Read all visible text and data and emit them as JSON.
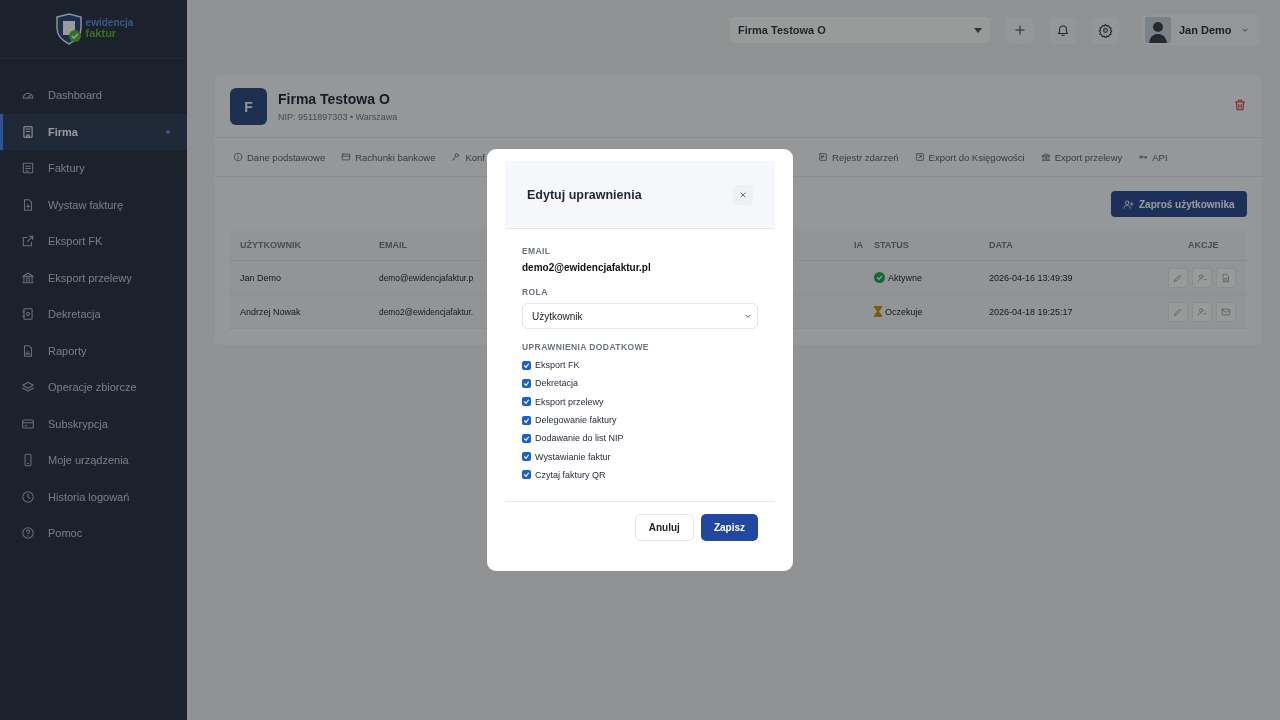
{
  "logo": {
    "line1": "ewidencja",
    "line2": "faktur"
  },
  "sidebar": {
    "items": [
      {
        "label": "Dashboard",
        "selected": false
      },
      {
        "label": "Firma",
        "selected": true
      },
      {
        "label": "Faktury",
        "selected": false
      },
      {
        "label": "Wystaw fakturę",
        "selected": false
      },
      {
        "label": "Eksport FK",
        "selected": false
      },
      {
        "label": "Eksport przelewy",
        "selected": false
      },
      {
        "label": "Dekretacja",
        "selected": false
      },
      {
        "label": "Raporty",
        "selected": false
      },
      {
        "label": "Operacje zbiorcze",
        "selected": false
      },
      {
        "label": "Subskrypcja",
        "selected": false
      },
      {
        "label": "Moje urządzenia",
        "selected": false
      },
      {
        "label": "Historia logowań",
        "selected": false
      },
      {
        "label": "Pomoc",
        "selected": false
      }
    ]
  },
  "topbar": {
    "company_select": "Firma Testowa O",
    "user": "Jan Demo"
  },
  "company": {
    "initial": "F",
    "name": "Firma Testowa O",
    "details": "NIP: 9511897303 • Warszawa"
  },
  "tabs_left": [
    "Dane podstawowe",
    "Rachunki bankowe",
    "Konf"
  ],
  "tabs_right": [
    "Rejestr zdarzeń",
    "Export do Księgowości",
    "Export przelewy",
    "API"
  ],
  "invite_button": "Zaproś użytkownika",
  "table": {
    "columns": [
      "UŻYTKOWNIK",
      "EMAIL",
      "IA",
      "STATUS",
      "DATA",
      "AKCJE"
    ],
    "rows": [
      {
        "user": "Jan Demo",
        "email": "demo@ewidencjafaktur.p",
        "status": {
          "kind": "active",
          "label": "Aktywne"
        },
        "date": "2026-04-16 13:49:39",
        "third_action": {
          "kind": "document"
        }
      },
      {
        "user": "Andrzej Nowak",
        "email": "demo2@ewidencjafaktur.",
        "status": {
          "kind": "pending",
          "label": "Oczekuje"
        },
        "date": "2026-04-18 19:25:17",
        "third_action": {
          "kind": "mail"
        }
      }
    ]
  },
  "modal": {
    "title": "Edytuj uprawnienia",
    "email_label": "EMAIL",
    "email": "demo2@ewidencjafaktur.pl",
    "role_label": "ROLA",
    "role": "Użytkownik",
    "permissions_label": "UPRAWNIENIA DODATKOWE",
    "permissions": [
      {
        "label": "Eksport FK",
        "checked": true
      },
      {
        "label": "Dekretacja",
        "checked": true
      },
      {
        "label": "Eksport przelewy",
        "checked": true
      },
      {
        "label": "Delegowanie faktury",
        "checked": true
      },
      {
        "label": "Dodawanie do list NIP",
        "checked": true
      },
      {
        "label": "Wystawianie faktur",
        "checked": true
      },
      {
        "label": "Czytaj faktury QR",
        "checked": true
      }
    ],
    "cancel": "Anuluj",
    "save": "Zapisz"
  }
}
